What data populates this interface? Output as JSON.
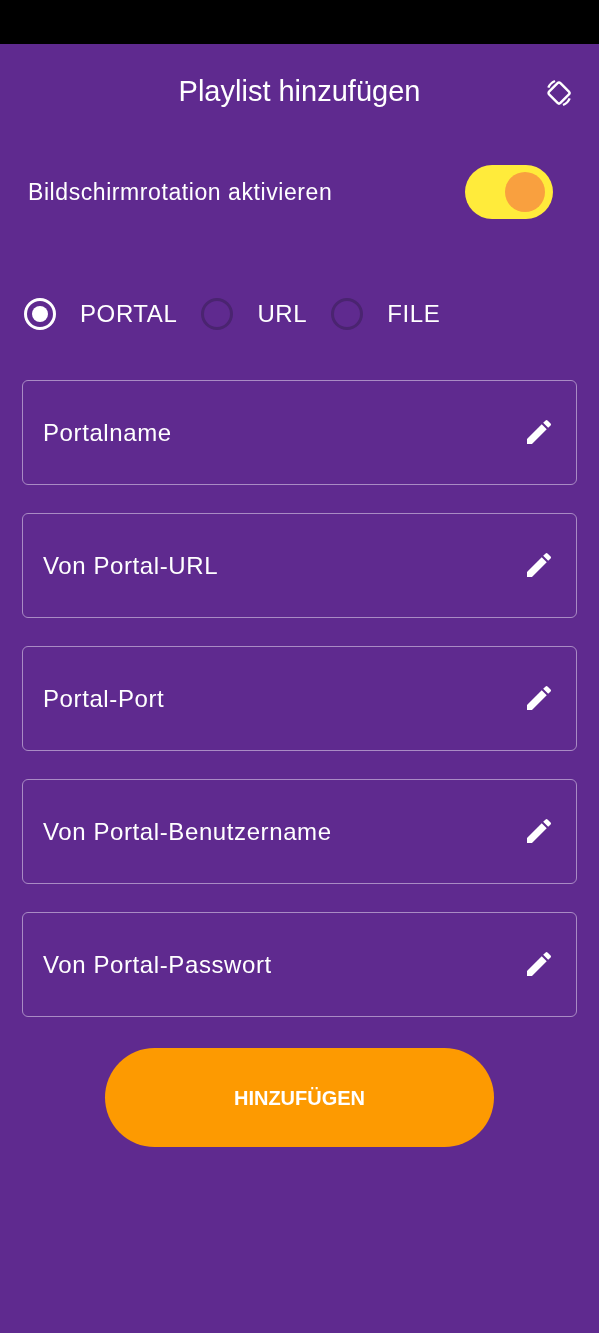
{
  "header": {
    "title": "Playlist hinzufügen"
  },
  "rotation": {
    "label": "Bildschirmrotation aktivieren",
    "on": true
  },
  "source_options": [
    {
      "label": "PORTAL",
      "selected": true
    },
    {
      "label": "URL",
      "selected": false
    },
    {
      "label": "FILE",
      "selected": false
    }
  ],
  "fields": [
    {
      "placeholder": "Portalname"
    },
    {
      "placeholder": "Von Portal-URL"
    },
    {
      "placeholder": "Portal-Port"
    },
    {
      "placeholder": "Von Portal-Benutzername"
    },
    {
      "placeholder": "Von Portal-Passwort"
    }
  ],
  "submit": {
    "label": "HINZUFÜGEN"
  }
}
